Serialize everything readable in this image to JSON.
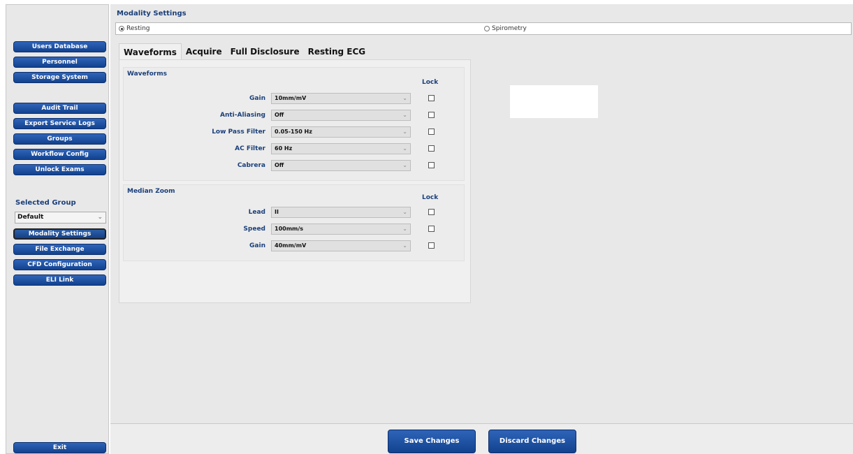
{
  "sidebar": {
    "buttons": {
      "users_database": "Users Database",
      "personnel": "Personnel",
      "storage_system": "Storage System",
      "audit_trail": "Audit Trail",
      "export_service_logs": "Export Service Logs",
      "groups": "Groups",
      "workflow_config": "Workflow Config",
      "unlock_exams": "Unlock Exams",
      "modality_settings": "Modality Settings",
      "file_exchange": "File Exchange",
      "cfd_configuration": "CFD Configuration",
      "eli_link": "ELI Link",
      "exit": "Exit"
    },
    "selected_group_label": "Selected Group",
    "selected_group_value": "Default"
  },
  "main": {
    "title": "Modality Settings",
    "modality_options": {
      "resting": "Resting",
      "spirometry": "Spirometry"
    },
    "selected_modality": "Resting",
    "tabs": [
      "Waveforms",
      "Acquire",
      "Full Disclosure",
      "Resting ECG"
    ],
    "active_tab": "Waveforms",
    "waveforms_section": {
      "title": "Waveforms",
      "lock_label": "Lock",
      "rows": [
        {
          "label": "Gain",
          "value": "10mm/mV",
          "locked": false
        },
        {
          "label": "Anti-Aliasing",
          "value": "Off",
          "locked": false
        },
        {
          "label": "Low Pass Filter",
          "value": "0.05-150 Hz",
          "locked": false
        },
        {
          "label": "AC Filter",
          "value": "60 Hz",
          "locked": false
        },
        {
          "label": "Cabrera",
          "value": "Off",
          "locked": false
        }
      ]
    },
    "median_zoom_section": {
      "title": "Median Zoom",
      "lock_label": "Lock",
      "rows": [
        {
          "label": "Lead",
          "value": "II",
          "locked": false
        },
        {
          "label": "Speed",
          "value": "100mm/s",
          "locked": false
        },
        {
          "label": "Gain",
          "value": "40mm/mV",
          "locked": false
        }
      ]
    }
  },
  "footer": {
    "save_label": "Save Changes",
    "discard_label": "Discard Changes"
  },
  "colors": {
    "button_blue": "#1f55a8",
    "label_blue": "#1a3f7a",
    "panel_gray": "#e8e8e8"
  }
}
